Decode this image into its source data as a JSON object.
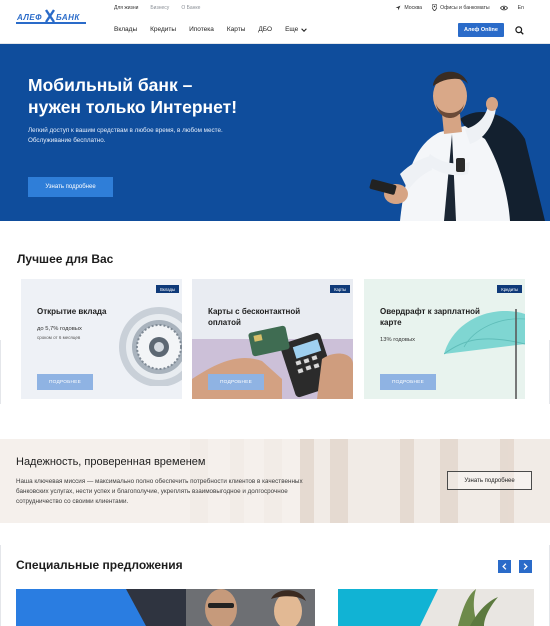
{
  "header": {
    "logo_text": "АЛЕФ БАНК",
    "top_nav": [
      "Для жизни",
      "Бизнесу",
      "О Банке"
    ],
    "top_right": {
      "city": "Москва",
      "offices": "Офисы и банкоматы",
      "lang": "En"
    },
    "main_nav": [
      "Вклады",
      "Кредиты",
      "Ипотека",
      "Карты",
      "ДБО",
      "Еще"
    ],
    "online_button": "Алеф Online"
  },
  "hero": {
    "title_line1": "Мобильный банк –",
    "title_line2": "нужен только Интернет!",
    "text_line1": "Легкий доступ к вашим средствам в любое время, в любом месте.",
    "text_line2": "Обслуживание бесплатно.",
    "button": "Узнать подробнее"
  },
  "best": {
    "title": "Лучшее для Вас",
    "cards": [
      {
        "tag": "Вклады",
        "title": "Открытие вклада",
        "sub": "до 5,7% годовых",
        "sub2": "сроком от 6 месяцев",
        "button": "ПОДРОБНЕЕ"
      },
      {
        "tag": "Карты",
        "title": "Карты с бесконтактной оплатой",
        "sub": "",
        "sub2": "",
        "button": "ПОДРОБНЕЕ"
      },
      {
        "tag": "Кредиты",
        "title": "Овердрафт к зарплатной карте",
        "sub": "13% годовых",
        "sub2": "",
        "button": "ПОДРОБНЕЕ"
      }
    ]
  },
  "reliability": {
    "title": "Надежность, проверенная временем",
    "text_line1": "Наша ключевая миссия — максимально полно обеспечить потребности клиентов в качественных",
    "text_line2": "банковских услугах, нести успех и благополучие, укреплять взаимовыгодное и долгосрочное",
    "text_line3": "сотрудничество со своими клиентами.",
    "button": "Узнать подробнее"
  },
  "special": {
    "title": "Специальные предложения"
  },
  "colors": {
    "brand_blue": "#0f4d9c",
    "button_blue": "#2a6bc9",
    "tag_navy": "#0f3a79"
  }
}
